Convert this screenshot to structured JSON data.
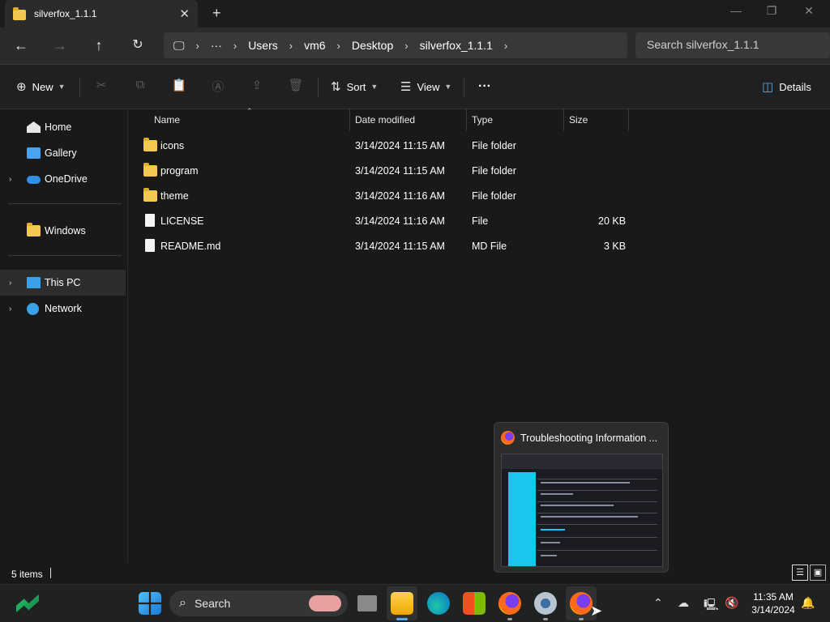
{
  "window": {
    "tab_title": "silverfox_1.1.1",
    "new_tab_symbol": "+",
    "close_symbol": "✕"
  },
  "navigation": {
    "breadcrumb": [
      "Users",
      "vm6",
      "Desktop",
      "silverfox_1.1.1"
    ],
    "overflow": "···",
    "search_placeholder": "Search silverfox_1.1.1"
  },
  "commandbar": {
    "new_label": "New",
    "sort_label": "Sort",
    "view_label": "View",
    "more_label": "···",
    "details_label": "Details"
  },
  "sidebar": {
    "items": [
      {
        "label": "Home",
        "icon": "home-icon"
      },
      {
        "label": "Gallery",
        "icon": "gallery-icon"
      },
      {
        "label": "OneDrive",
        "icon": "cloud-icon"
      },
      {
        "label": "Windows",
        "icon": "folder-icon"
      },
      {
        "label": "This PC",
        "icon": "computer-icon"
      },
      {
        "label": "Network",
        "icon": "network-icon"
      }
    ]
  },
  "filelist": {
    "columns": [
      "Name",
      "Date modified",
      "Type",
      "Size"
    ],
    "rows": [
      {
        "name": "icons",
        "date": "3/14/2024 11:15 AM",
        "type": "File folder",
        "size": "",
        "kind": "folder"
      },
      {
        "name": "program",
        "date": "3/14/2024 11:15 AM",
        "type": "File folder",
        "size": "",
        "kind": "folder"
      },
      {
        "name": "theme",
        "date": "3/14/2024 11:16 AM",
        "type": "File folder",
        "size": "",
        "kind": "folder"
      },
      {
        "name": "LICENSE",
        "date": "3/14/2024 11:16 AM",
        "type": "File",
        "size": "20 KB",
        "kind": "file"
      },
      {
        "name": "README.md",
        "date": "3/14/2024 11:15 AM",
        "type": "MD File",
        "size": "3 KB",
        "kind": "file"
      }
    ]
  },
  "status": {
    "item_count": "5 items"
  },
  "preview": {
    "title": "Troubleshooting Information ..."
  },
  "taskbar": {
    "search_label": "Search",
    "time": "11:35 AM",
    "date": "3/14/2024"
  }
}
